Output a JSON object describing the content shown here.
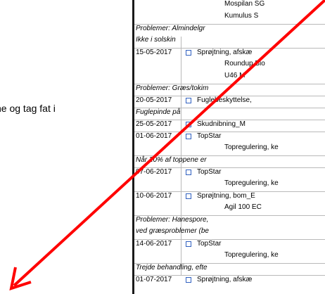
{
  "left_text": "ne og tag fat i",
  "rows": [
    {
      "type": "sub",
      "text": "Mospilan SG"
    },
    {
      "type": "sub",
      "text": "Kumulus S"
    },
    {
      "type": "note",
      "text": "Problemer: Almindelgr"
    },
    {
      "type": "note",
      "text": "Ikke i solskin"
    },
    {
      "type": "entry",
      "date": "15-05-2017",
      "text": "Sprøjtning, afskæ"
    },
    {
      "type": "sub",
      "text": "Roundup Bio"
    },
    {
      "type": "sub",
      "text": "U46 M"
    },
    {
      "type": "note",
      "text": "Problemer: Græs/tokim"
    },
    {
      "type": "entry",
      "date": "20-05-2017",
      "text": "Fuglebeskyttelse,"
    },
    {
      "type": "note",
      "text": "Fuglepinde på"
    },
    {
      "type": "entry",
      "date": "25-05-2017",
      "text": "Skudnibning_M"
    },
    {
      "type": "entry",
      "date": "01-06-2017",
      "text": "TopStar"
    },
    {
      "type": "sub",
      "text": "Topregulering, ke"
    },
    {
      "type": "note",
      "text": "Når 20% af toppene er"
    },
    {
      "type": "entry",
      "date": "07-06-2017",
      "text": "TopStar"
    },
    {
      "type": "sub",
      "text": "Topregulering, ke"
    },
    {
      "type": "entry",
      "date": "10-06-2017",
      "text": "Sprøjtning, bom_E"
    },
    {
      "type": "sub",
      "text": "Agil 100 EC"
    },
    {
      "type": "note",
      "text": "Problemer: Hanespore,"
    },
    {
      "type": "note",
      "text": "ved græsproblemer (be"
    },
    {
      "type": "entry",
      "date": "14-06-2017",
      "text": "TopStar"
    },
    {
      "type": "sub",
      "text": "Topregulering, ke"
    },
    {
      "type": "note",
      "text": "Trejde behandling, efte"
    },
    {
      "type": "entry",
      "date": "01-07-2017",
      "text": "Sprøjtning, afskæ"
    }
  ],
  "arrow_color": "#ff0000",
  "checkbox_color": "#3060c0"
}
